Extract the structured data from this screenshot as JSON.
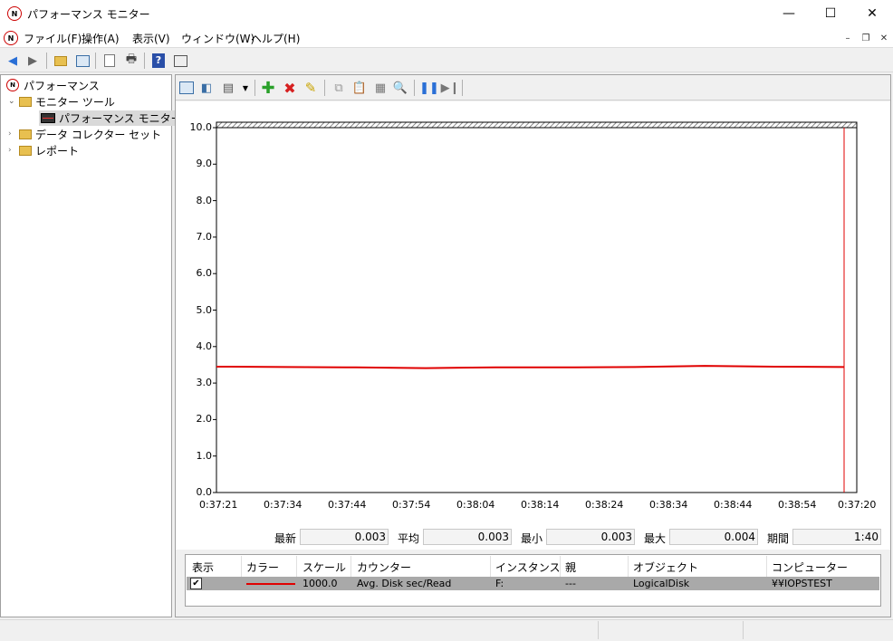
{
  "window": {
    "title": "パフォーマンス モニター",
    "minimize": "—",
    "maximize": "☐",
    "close": "✕"
  },
  "menu": [
    "ファイル(F)",
    "操作(A)",
    "表示(V)",
    "ウィンドウ(W)",
    "ヘルプ(H)"
  ],
  "tree": {
    "root": "パフォーマンス",
    "monitor_tools": "モニター ツール",
    "perf_monitor": "パフォーマンス モニター",
    "data_collector": "データ コレクター セット",
    "reports": "レポート"
  },
  "graph": {
    "y_ticks": [
      "10.0",
      "9.0",
      "8.0",
      "7.0",
      "6.0",
      "5.0",
      "4.0",
      "3.0",
      "2.0",
      "1.0",
      "0.0"
    ],
    "x_ticks": [
      "0:37:21",
      "0:37:34",
      "0:37:44",
      "0:37:54",
      "0:38:04",
      "0:38:14",
      "0:38:24",
      "0:38:34",
      "0:38:44",
      "0:38:54",
      "0:37:20"
    ]
  },
  "chart_data": {
    "type": "line",
    "ylim": [
      0,
      10
    ],
    "x": [
      "0:37:21",
      "0:37:34",
      "0:37:44",
      "0:37:54",
      "0:38:04",
      "0:38:14",
      "0:38:24",
      "0:38:34",
      "0:38:44",
      "0:38:54"
    ],
    "series": [
      {
        "values": [
          3.45,
          3.44,
          3.43,
          3.41,
          3.43,
          3.43,
          3.44,
          3.47,
          3.45,
          3.44
        ],
        "color": "#e00000"
      }
    ]
  },
  "stats": {
    "latest_label": "最新",
    "latest": "0.003",
    "avg_label": "平均",
    "avg": "0.003",
    "min_label": "最小",
    "min": "0.003",
    "max_label": "最大",
    "max": "0.004",
    "duration_label": "期間",
    "duration": "1:40"
  },
  "table": {
    "headers": [
      "表示",
      "カラー",
      "スケール",
      "カウンター",
      "インスタンス",
      "親",
      "オブジェクト",
      "コンピューター"
    ],
    "row": {
      "show": "✔",
      "scale": "1000.0",
      "counter": "Avg. Disk sec/Read",
      "instance": "F:",
      "parent": "---",
      "object": "LogicalDisk",
      "computer": "¥¥IOPSTEST"
    }
  }
}
